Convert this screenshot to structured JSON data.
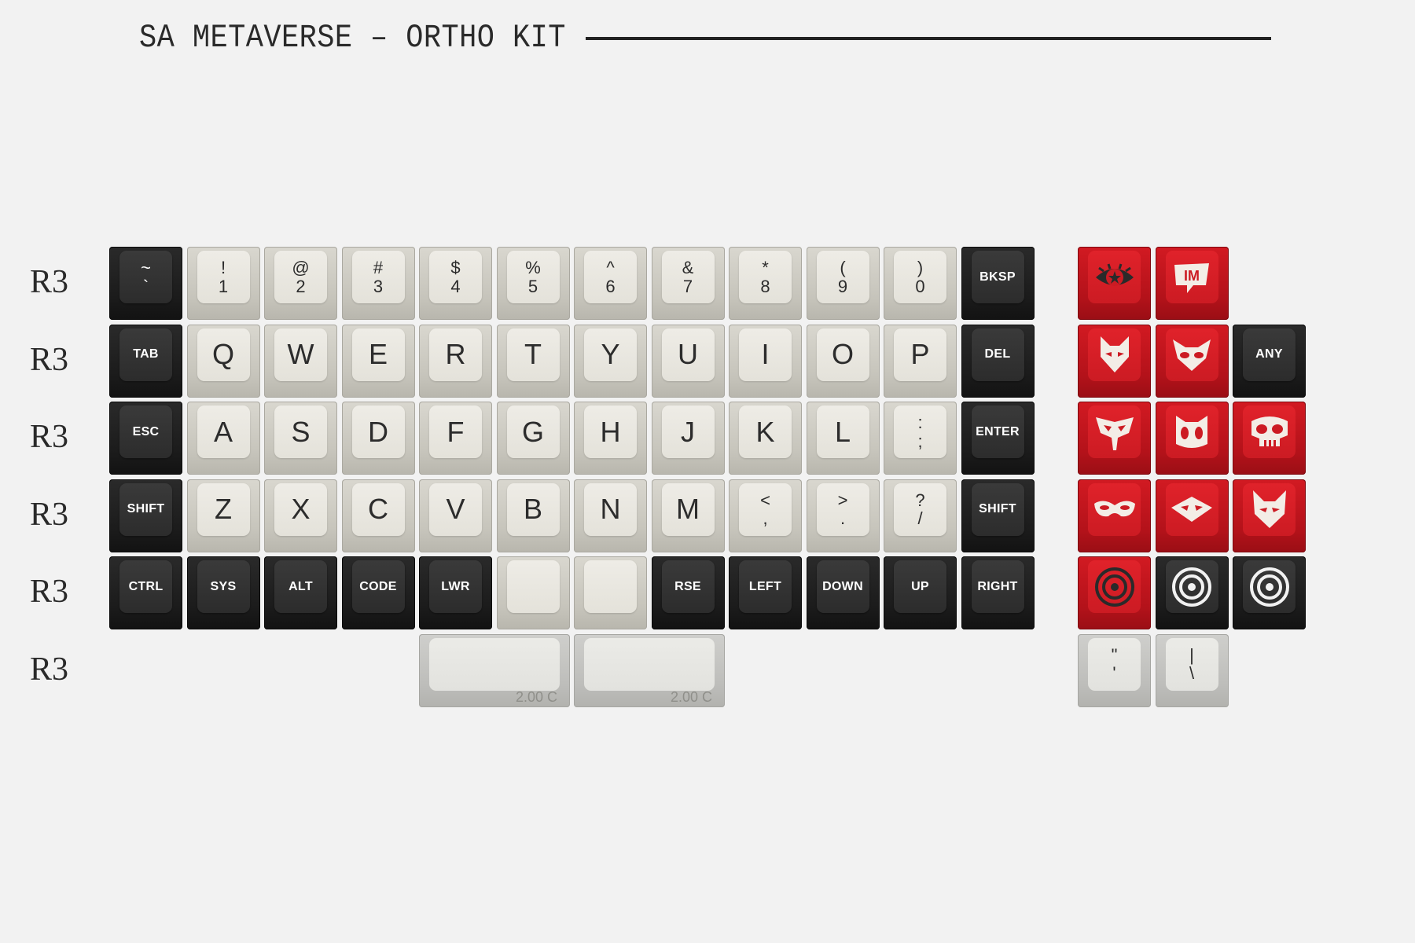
{
  "title": "SA METAVERSE – ORTHO KIT",
  "row_labels": [
    "R3",
    "R3",
    "R3",
    "R3",
    "R3",
    "R3"
  ],
  "colors": {
    "background": "#f2f2f2",
    "white_key": "#e4e2da",
    "black_key": "#2c2c2c",
    "red_key": "#cc1b23",
    "grey_key": "#e2e2de"
  },
  "keys": {
    "r1": [
      "~\n`",
      "!\n1",
      "@\n2",
      "#\n3",
      "$\n4",
      "%\n5",
      "^\n6",
      "&\n7",
      "*\n8",
      "(\n9",
      ")\n0",
      "BKSP"
    ],
    "r2": [
      "TAB",
      "Q",
      "W",
      "E",
      "R",
      "T",
      "Y",
      "U",
      "I",
      "O",
      "P",
      "DEL"
    ],
    "r3": [
      "ESC",
      "A",
      "S",
      "D",
      "F",
      "G",
      "H",
      "J",
      "K",
      "L",
      ":\n;",
      "ENTER"
    ],
    "r4": [
      "SHIFT",
      "Z",
      "X",
      "C",
      "V",
      "B",
      "N",
      "M",
      "<\n,",
      ">\n.",
      "?\n/",
      "SHIFT"
    ],
    "r5": [
      "CTRL",
      "SYS",
      "ALT",
      "CODE",
      "LWR",
      "",
      "",
      "RSE",
      "LEFT",
      "DOWN",
      "UP",
      "RIGHT"
    ],
    "spacebars": [
      {
        "size_label": "2.00 C"
      },
      {
        "size_label": "2.00 C"
      }
    ],
    "accent": {
      "any_label": "ANY",
      "quote": "\"\n'",
      "pipe": "|\n\\"
    }
  },
  "icons": {
    "r1": [
      "eye-star-icon",
      "im-logo-icon"
    ],
    "r2": [
      "fox-mask-icon",
      "cat-mask-icon"
    ],
    "r3": [
      "skull-mask-icon",
      "cat-face-icon",
      "skull-icon"
    ],
    "r4": [
      "domino-mask-icon",
      "diamond-mask-icon",
      "devil-cat-icon"
    ],
    "r5": [
      "red-target-icon",
      "white-target-icon",
      "white-target-icon"
    ]
  }
}
